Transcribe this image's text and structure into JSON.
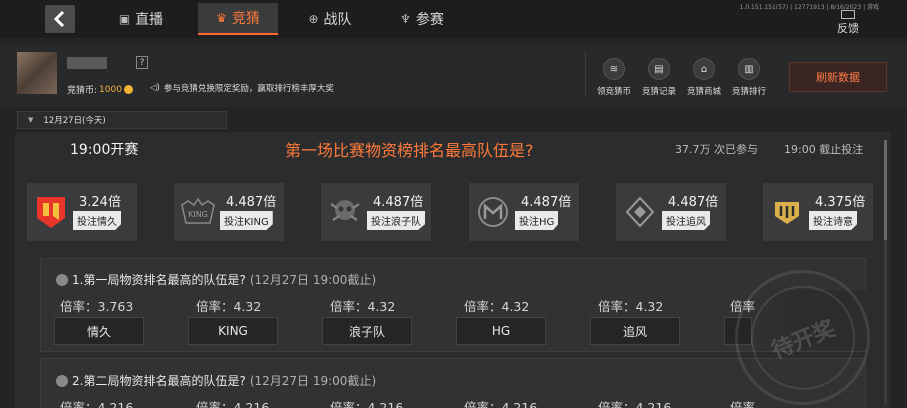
{
  "nav": {
    "tabs": [
      {
        "label": "直播",
        "icon": "live-tv-icon"
      },
      {
        "label": "竞猜",
        "icon": "guess-icon"
      },
      {
        "label": "战队",
        "icon": "crosshair-icon"
      },
      {
        "label": "参赛",
        "icon": "trophy-icon"
      }
    ],
    "active_tab": "竞猜",
    "sysinfo": "1.0.151.151(57) | 12771913 | 8/16/2023 | 游戏",
    "feedback_label": "反馈"
  },
  "profile": {
    "coins_label": "竞猜币:",
    "coins_value": "1000",
    "notice": "参与竞猜兑换限定奖励，赢取排行榜丰厚大奖",
    "help": "?"
  },
  "quick_actions": [
    {
      "label": "领竞猜币",
      "icon": "coin-stack-icon"
    },
    {
      "label": "竞猜记录",
      "icon": "document-icon"
    },
    {
      "label": "竞猜商城",
      "icon": "shop-icon"
    },
    {
      "label": "竞猜排行",
      "icon": "bar-chart-icon"
    }
  ],
  "refresh_label": "刷新数据",
  "date_selected": "12月27日(今天)",
  "question": {
    "time": "19:00开赛",
    "title": "第一场比赛物资榜排名最高队伍是?",
    "participants": "37.7万 次已参与",
    "deadline": "19:00 截止投注"
  },
  "teams": [
    {
      "odds": "3.24倍",
      "bet_label": "投注情久",
      "color": "#e8362a"
    },
    {
      "odds": "4.487倍",
      "bet_label": "投注KING",
      "color": "#9a9a9a"
    },
    {
      "odds": "4.487倍",
      "bet_label": "投注浪子队",
      "color": "#9a9a9a"
    },
    {
      "odds": "4.487倍",
      "bet_label": "投注HG",
      "color": "#9a9a9a"
    },
    {
      "odds": "4.487倍",
      "bet_label": "投注追风",
      "color": "#9a9a9a"
    },
    {
      "odds": "4.375倍",
      "bet_label": "投注诗意",
      "color": "#d9b04a"
    }
  ],
  "sub_questions": [
    {
      "title": "1.第一局物资排名最高的队伍是?",
      "deadline": "(12月27日 19:00截止)",
      "options": [
        {
          "odds": "倍率：3.763",
          "team": "情久"
        },
        {
          "odds": "倍率：4.32",
          "team": "KING"
        },
        {
          "odds": "倍率：4.32",
          "team": "浪子队"
        },
        {
          "odds": "倍率：4.32",
          "team": "HG"
        },
        {
          "odds": "倍率：4.32",
          "team": "追风"
        },
        {
          "odds": "倍率",
          "team": ""
        }
      ]
    },
    {
      "title": "2.第二局物资排名最高的队伍是?",
      "deadline": "(12月27日 19:00截止)",
      "options": [
        {
          "odds": "倍率：4.216",
          "team": ""
        },
        {
          "odds": "倍率：4.216",
          "team": ""
        },
        {
          "odds": "倍率：4.216",
          "team": ""
        },
        {
          "odds": "倍率：4.216",
          "team": ""
        },
        {
          "odds": "倍率：4.216",
          "team": ""
        },
        {
          "odds": "倍率",
          "team": ""
        }
      ]
    }
  ],
  "stamp_text": "待开奖"
}
